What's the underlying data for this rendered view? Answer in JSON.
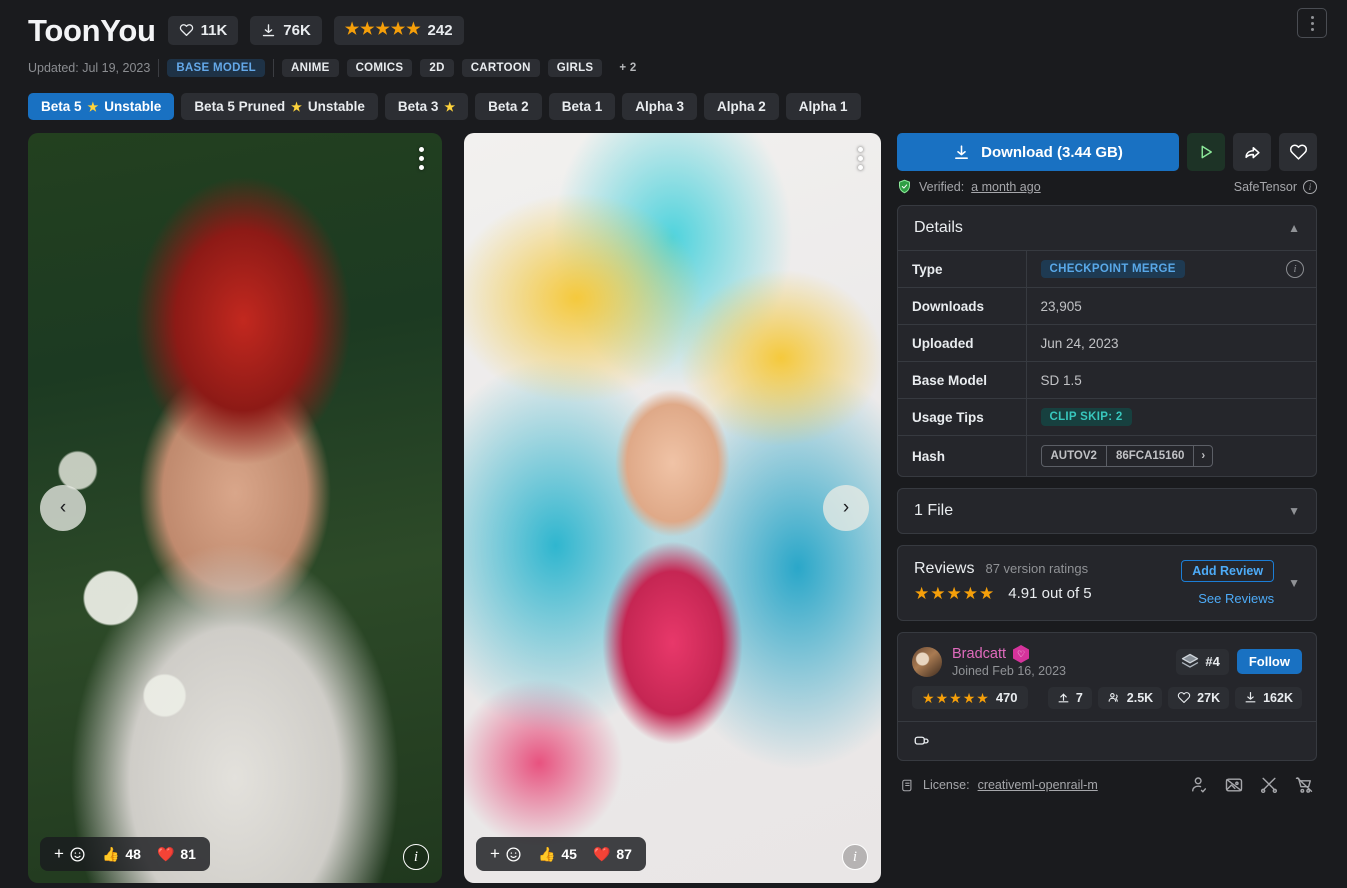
{
  "header": {
    "title": "ToonYou",
    "likes": "11K",
    "downloads": "76K",
    "rating_count": "242",
    "updated": "Updated: Jul 19, 2023",
    "tags": [
      "BASE MODEL",
      "ANIME",
      "COMICS",
      "2D",
      "CARTOON",
      "GIRLS"
    ],
    "more_tags": "+ 2",
    "menu_icon": "kebab-menu-icon"
  },
  "versions": [
    {
      "label": "Beta 5",
      "sparkle": "★",
      "suffix": "Unstable",
      "active": true
    },
    {
      "label": "Beta 5 Pruned",
      "sparkle": "★",
      "suffix": "Unstable",
      "active": false
    },
    {
      "label": "Beta 3",
      "sparkle": "★",
      "suffix": "",
      "active": false
    },
    {
      "label": "Beta 2",
      "sparkle": "",
      "suffix": "",
      "active": false
    },
    {
      "label": "Beta 1",
      "sparkle": "",
      "suffix": "",
      "active": false
    },
    {
      "label": "Alpha 3",
      "sparkle": "",
      "suffix": "",
      "active": false
    },
    {
      "label": "Alpha 2",
      "sparkle": "",
      "suffix": "",
      "active": false
    },
    {
      "label": "Alpha 1",
      "sparkle": "",
      "suffix": "",
      "active": false
    }
  ],
  "gallery": {
    "prev_arrow": "‹",
    "next_arrow": "›",
    "images": [
      {
        "alt": "Red-haired cartoon girl in white shirt among daisies",
        "add_reaction": "+",
        "thumbs_up": "48",
        "hearts": "81",
        "info": "i"
      },
      {
        "alt": "Cartoon girl with flowing blue and yellow hair in pink dress",
        "add_reaction": "+",
        "thumbs_up": "45",
        "hearts": "87",
        "info": "i"
      }
    ]
  },
  "sidebar": {
    "download_label": "Download (3.44 GB)",
    "play_icon": "play-icon",
    "share_icon": "share-icon",
    "favorite_icon": "heart-icon",
    "verified_prefix": "Verified:",
    "verified_link": "a month ago",
    "safetensor_label": "SafeTensor",
    "details": {
      "heading": "Details",
      "rows": [
        {
          "key": "Type",
          "value": "CHECKPOINT MERGE",
          "style": "badge-blue",
          "info": true
        },
        {
          "key": "Downloads",
          "value": "23,905",
          "style": "plain",
          "info": false
        },
        {
          "key": "Uploaded",
          "value": "Jun 24, 2023",
          "style": "plain",
          "info": false
        },
        {
          "key": "Base Model",
          "value": "SD 1.5",
          "style": "plain",
          "info": false
        },
        {
          "key": "Usage Tips",
          "value": "CLIP SKIP: 2",
          "style": "badge-teal",
          "info": false
        },
        {
          "key": "Hash",
          "value": "",
          "style": "hash",
          "info": false
        }
      ],
      "hash_type": "AUTOV2",
      "hash_value": "86FCA15160",
      "hash_next": "›"
    },
    "files": {
      "heading": "1 File"
    },
    "reviews": {
      "title": "Reviews",
      "version_ratings": "87 version ratings",
      "score": "4.91 out of 5",
      "add_review": "Add Review",
      "see_reviews": "See Reviews"
    },
    "creator": {
      "name": "Bradcatt",
      "joined": "Joined Feb 16, 2023",
      "rank": "#4",
      "follow": "Follow",
      "rating_count": "470",
      "uploads": "7",
      "followers": "2.5K",
      "likes": "27K",
      "downloads": "162K",
      "tip_icon": "coffee-icon"
    },
    "license": {
      "prefix": "License:",
      "link": "creativeml-openrail-m",
      "icons": [
        "no-credit-icon",
        "no-image-sale-icon",
        "no-merge-icon",
        "no-sell-icon"
      ]
    }
  },
  "colors": {
    "background": "#1a1b1e",
    "card": "#25262b",
    "accent_blue": "#1971c2",
    "star_gold": "#f59f0a",
    "link_blue": "#4dabf7",
    "creator_pink": "#e06bbd"
  }
}
